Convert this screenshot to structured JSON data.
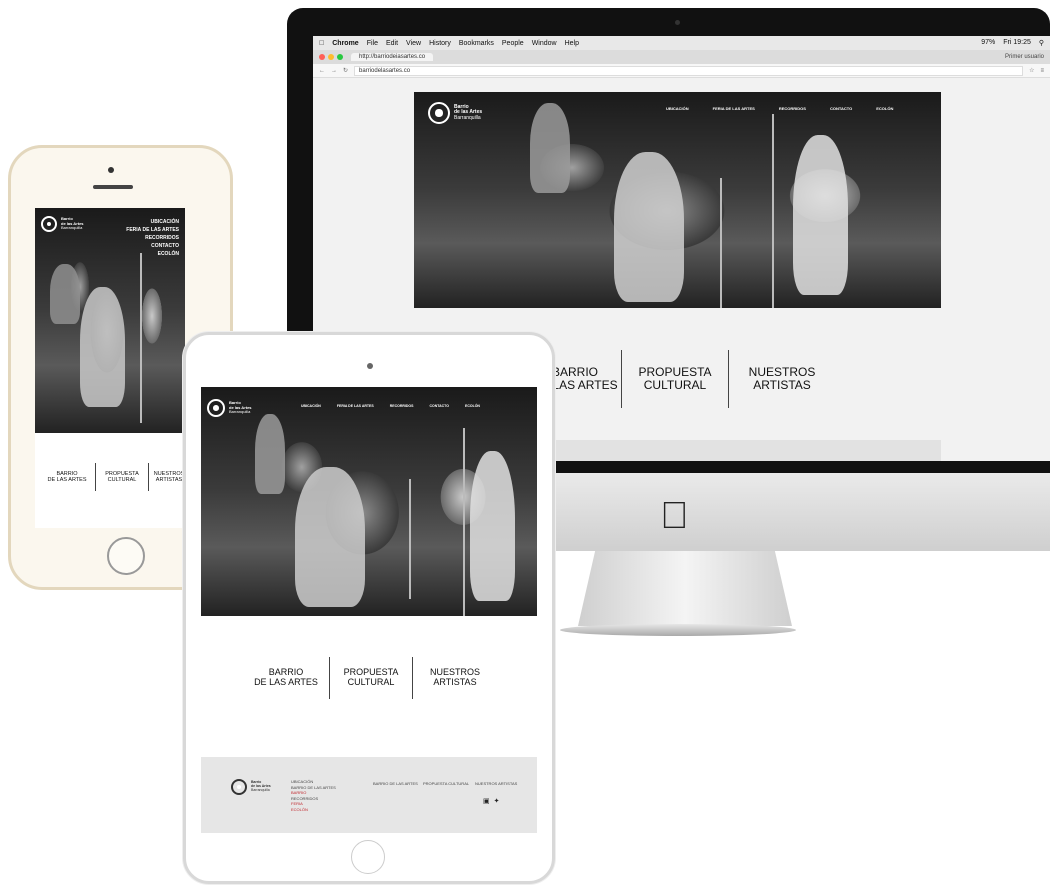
{
  "imac": {
    "menubar": {
      "app_name": "Chrome",
      "items": [
        "File",
        "Edit",
        "View",
        "History",
        "Bookmarks",
        "People",
        "Window",
        "Help"
      ],
      "status": "97%",
      "clock": "Fri 19:25"
    },
    "tabbar": {
      "tab_label": "http://barriodeiasartes.co",
      "user_label": "Primer usuario"
    },
    "addressbar": {
      "url": "barriodelasartes.co"
    },
    "site": {
      "logo_lines": [
        "Barrio",
        "de las Artes",
        "Barranquilla"
      ],
      "nav": [
        "UBICACIÓN",
        "FERIA DE LAS ARTES",
        "RECORRIDOS",
        "CONTACTO",
        "ECOLÓN"
      ],
      "sections": [
        "BARRIO\nDE LAS ARTES",
        "PROPUESTA\nCULTURAL",
        "NUESTROS\nARTISTAS"
      ]
    }
  },
  "iphone": {
    "logo_lines": [
      "Barrio",
      "de las Artes",
      "Barranquilla"
    ],
    "nav": [
      "UBICACIÓN",
      "FERIA DE LAS ARTES",
      "RECORRIDOS",
      "CONTACTO",
      "ECOLÓN"
    ],
    "sections": [
      "BARRIO\nDE LAS ARTES",
      "PROPUESTA\nCULTURAL",
      "NUESTROS\nARTISTAS"
    ]
  },
  "ipad": {
    "logo_lines": [
      "Barrio",
      "de las Artes",
      "Barranquilla"
    ],
    "nav": [
      "UBICACIÓN",
      "FERIA DE LAS ARTES",
      "RECORRIDOS",
      "CONTACTO",
      "ECOLÓN"
    ],
    "sections": [
      "BARRIO\nDE LAS ARTES",
      "PROPUESTA\nCULTURAL",
      "NUESTROS\nARTISTAS"
    ],
    "footer": {
      "logo_lines": [
        "Barrio",
        "de las Artes",
        "Barranquilla"
      ],
      "col1": [
        "UBICACIÓN",
        "BARRIO DE LAS ARTES",
        "BARRIO",
        "RECORRIDOS",
        "FERIA",
        "ECOLÓN"
      ],
      "col2": "BARRIO DE LAS ARTES",
      "col3": "PROPUESTA CULTURAL",
      "col4": "NUESTROS ARTISTAS"
    }
  },
  "colors": {
    "accent_red": "#c0272d",
    "close": "#ff5f57",
    "minimize": "#febc2e",
    "maximize": "#28c840"
  }
}
